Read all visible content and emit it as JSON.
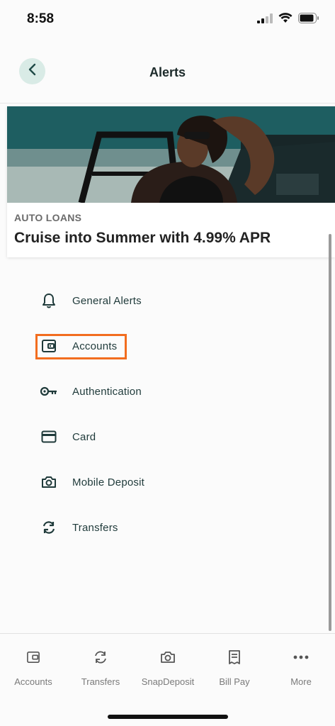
{
  "status_bar": {
    "time": "8:58"
  },
  "header": {
    "title": "Alerts"
  },
  "promo": {
    "eyebrow": "AUTO LOANS",
    "headline": "Cruise into Summer with 4.99% APR"
  },
  "alerts": [
    {
      "label": "General Alerts",
      "icon": "bell-icon"
    },
    {
      "label": "Accounts",
      "icon": "wallet-icon",
      "highlighted": true
    },
    {
      "label": "Authentication",
      "icon": "key-icon"
    },
    {
      "label": "Card",
      "icon": "credit-card-icon"
    },
    {
      "label": "Mobile Deposit",
      "icon": "camera-icon"
    },
    {
      "label": "Transfers",
      "icon": "transfer-arrows-icon"
    }
  ],
  "bottom_nav": [
    {
      "label": "Accounts",
      "icon": "wallet-icon"
    },
    {
      "label": "Transfers",
      "icon": "transfer-arrows-icon"
    },
    {
      "label": "SnapDeposit",
      "icon": "camera-icon"
    },
    {
      "label": "Bill Pay",
      "icon": "bill-icon"
    },
    {
      "label": "More",
      "icon": "more-dots-icon"
    }
  ],
  "colors": {
    "accent": "#f26d1f",
    "icon_dark": "#1f3a3a",
    "back_button_bg": "#d9ebe6",
    "promo_bg": "#1e5e61"
  }
}
